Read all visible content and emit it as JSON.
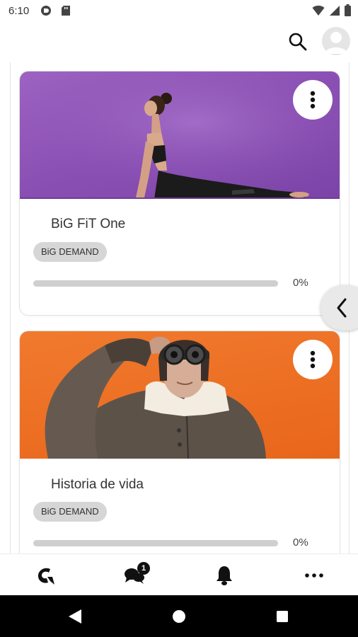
{
  "status_bar": {
    "time": "6:10",
    "left_icons": [
      "cast-icon",
      "sd-card-icon"
    ],
    "right_icons": [
      "wifi-icon",
      "signal-icon",
      "battery-icon"
    ]
  },
  "app_bar": {
    "search_icon": "search-icon",
    "avatar_icon": "person-icon"
  },
  "cards": [
    {
      "title": "BiG FiT One",
      "tag": "BiG DEMAND",
      "progress": 0,
      "progress_label": "0%",
      "image": "woman-yoga-cobra-pose-purple-background",
      "menu_icon": "more-vertical-icon"
    },
    {
      "title": "Historia de vida",
      "tag": "BiG DEMAND",
      "progress": 0,
      "progress_label": "0%",
      "image": "older-man-aviator-goggles-orange-background",
      "menu_icon": "more-vertical-icon"
    }
  ],
  "drawer_toggle_icon": "chevron-left-icon",
  "bottom_nav": {
    "items": [
      {
        "name": "home",
        "icon": "brand-logo-icon"
      },
      {
        "name": "chat",
        "icon": "chat-icon",
        "badge": "1"
      },
      {
        "name": "notifications",
        "icon": "bell-icon"
      },
      {
        "name": "more",
        "icon": "more-horizontal-icon"
      }
    ]
  },
  "system_nav": [
    "back-icon",
    "home-icon",
    "recents-icon"
  ],
  "colors": {
    "card1_bg": "#8a4fb3",
    "card2_bg": "#ec6e22",
    "chip_bg": "#d6d6d6",
    "progress_track": "#cfcfcf"
  }
}
